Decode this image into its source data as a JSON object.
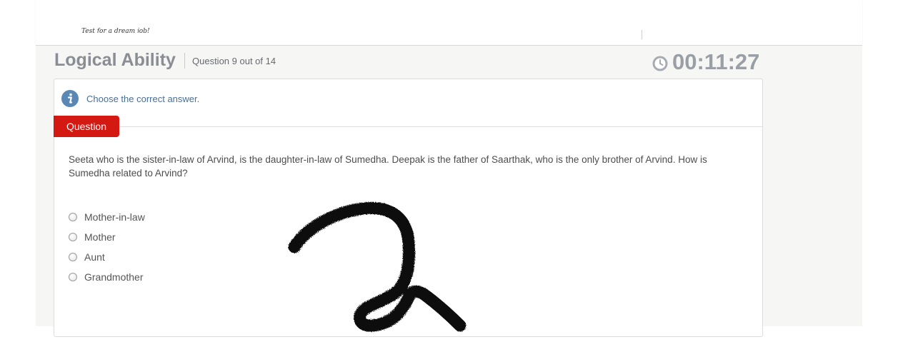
{
  "header": {
    "tagline": "Test for a dream job!"
  },
  "section": {
    "title": "Logical Ability",
    "counter": "Question 9 out of 14"
  },
  "timer": {
    "icon": "clock-icon",
    "value": "00:11:27"
  },
  "instruction": {
    "icon": "info-icon",
    "text": "Choose the correct answer."
  },
  "question": {
    "tab_label": "Question",
    "text": "Seeta who is the sister-in-law of Arvind, is the daughter-in-law of Sumedha. Deepak is the father of Saarthak, who is the only brother of Arvind. How is Sumedha related to Arvind?",
    "options": [
      {
        "label": "Mother-in-law",
        "selected": false
      },
      {
        "label": "Mother",
        "selected": false
      },
      {
        "label": "Aunt",
        "selected": false
      },
      {
        "label": "Grandmother",
        "selected": false
      }
    ]
  },
  "annotation": {
    "icon": "handwritten-scribble",
    "color": "#111111"
  },
  "colors": {
    "accent_red": "#d41812",
    "title_gray": "#8a8d93",
    "info_blue": "#4a6f95"
  }
}
